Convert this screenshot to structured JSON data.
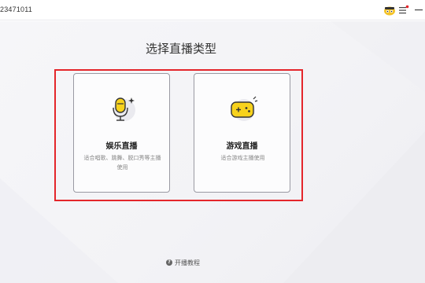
{
  "titlebar": {
    "room_id": "23471011",
    "avatar_icon": "avatar-emoji-icon",
    "menu_icon": "hamburger-menu-icon",
    "minimize_icon": "minimize-icon",
    "notification_color": "#e4262b"
  },
  "main": {
    "title": "选择直播类型",
    "cards": [
      {
        "title": "娱乐直播",
        "description": "适合唱歌、跳舞、脱口秀等主播使用",
        "icon": "microphone-icon"
      },
      {
        "title": "游戏直播",
        "description": "适合游戏主播使用",
        "icon": "gamepad-icon"
      }
    ],
    "tutorial_link": "开播教程",
    "tutorial_icon": "help-circle-icon"
  },
  "colors": {
    "accent_yellow": "#f7d21c",
    "highlight_red": "#e4262b"
  }
}
